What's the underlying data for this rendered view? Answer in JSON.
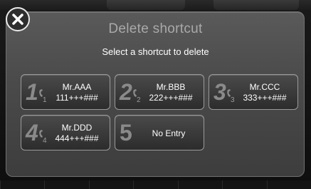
{
  "dialog": {
    "title": "Delete shortcut",
    "subtitle": "Select a shortcut to delete",
    "close_icon": "close-icon"
  },
  "shortcuts": [
    {
      "number": "1",
      "sub": "1",
      "name": "Mr.AAA",
      "phone": "111+++###",
      "icon": "phone-handset-icon"
    },
    {
      "number": "2",
      "sub": "2",
      "name": "Mr.BBB",
      "phone": "222+++###",
      "icon": "phone-handset-icon"
    },
    {
      "number": "3",
      "sub": "3",
      "name": "Mr.CCC",
      "phone": "333+++###",
      "icon": "phone-handset-icon"
    },
    {
      "number": "4",
      "sub": "4",
      "name": "Mr.DDD",
      "phone": "444+++###",
      "icon": "phone-handset-icon"
    },
    {
      "number": "5",
      "label": "No Entry"
    }
  ],
  "colors": {
    "dialog_bg": "#4b4b4b",
    "title_text": "#a9a9a9",
    "label_text": "#ffffff",
    "number_text": "#8a8a8a"
  }
}
